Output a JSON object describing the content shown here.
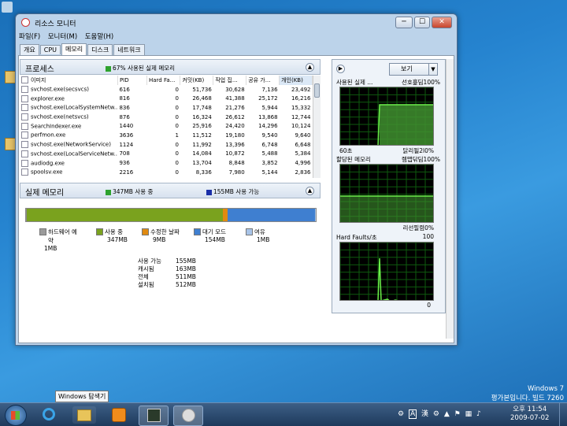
{
  "window": {
    "title": "리소스 모니터",
    "min": "─",
    "max": "☐",
    "close": "✕"
  },
  "menu": [
    "파일(F)",
    "모니터(M)",
    "도움말(H)"
  ],
  "tabs": [
    "개요",
    "CPU",
    "메모리",
    "디스크",
    "네트워크"
  ],
  "process_panel": {
    "title": "프로세스",
    "summary": "67% 사용된 실제 메모리",
    "summary_color": "#2ea22e",
    "columns": [
      "이미지",
      "PID",
      "Hard Fa...",
      "커밋(KB)",
      "작업 집...",
      "공유 가...",
      "개인(KB)"
    ],
    "rows": [
      [
        "svchost.exe(secsvcs)",
        "616",
        "0",
        "51,736",
        "30,628",
        "7,136",
        "23,492"
      ],
      [
        "explorer.exe",
        "816",
        "0",
        "26,468",
        "41,388",
        "25,172",
        "16,216"
      ],
      [
        "svchost.exe(LocalSystemNetw...",
        "836",
        "0",
        "17,748",
        "21,276",
        "5,944",
        "15,332"
      ],
      [
        "svchost.exe(netsvcs)",
        "876",
        "0",
        "16,324",
        "26,612",
        "13,868",
        "12,744"
      ],
      [
        "SearchIndexer.exe",
        "1440",
        "0",
        "25,916",
        "24,420",
        "14,296",
        "10,124"
      ],
      [
        "perfmon.exe",
        "3636",
        "1",
        "11,512",
        "19,180",
        "9,540",
        "9,640"
      ],
      [
        "svchost.exe(NetworkService)",
        "1124",
        "0",
        "11,992",
        "13,396",
        "6,748",
        "6,648"
      ],
      [
        "svchost.exe(LocalServiceNetw...",
        "708",
        "0",
        "14,084",
        "10,872",
        "5,488",
        "5,384"
      ],
      [
        "audiodg.exe",
        "936",
        "0",
        "13,704",
        "8,848",
        "3,852",
        "4,996"
      ],
      [
        "spoolsv.exe",
        "2216",
        "0",
        "8,336",
        "7,980",
        "5,144",
        "2,836"
      ]
    ]
  },
  "memory_panel": {
    "title": "실제 메모리",
    "in_use": "347MB 사용 중",
    "available": "155MB 사용 가능",
    "in_use_color": "#2ea22e",
    "available_color": "#1a2fa8",
    "bar": [
      {
        "label": "하드웨어 예약",
        "value_mb": 1,
        "color": "#8a8a8a"
      },
      {
        "label": "사용 중",
        "value_mb": 347,
        "color": "#7aa21e"
      },
      {
        "label": "수정한 날짜",
        "value_mb": 9,
        "color": "#e08a10"
      },
      {
        "label": "대기 모드",
        "value_mb": 154,
        "color": "#3f7fd0"
      },
      {
        "label": "여유",
        "value_mb": 1,
        "color": "#a8c4e8"
      }
    ],
    "legend": [
      {
        "label": "하드웨어 예\n약",
        "value": "1MB",
        "color": "#9a9a9a"
      },
      {
        "label": "사용 중",
        "value": "347MB",
        "color": "#7aa21e"
      },
      {
        "label": "수정한 날짜",
        "value": "9MB",
        "color": "#e08a10"
      },
      {
        "label": "대기 모드",
        "value": "154MB",
        "color": "#3f7fd0"
      },
      {
        "label": "여유",
        "value": "1MB",
        "color": "#a8c4e8"
      }
    ],
    "stats": [
      [
        "사용 가능",
        "155MB"
      ],
      [
        "캐시됨",
        "163MB"
      ],
      [
        "전체",
        "511MB"
      ],
      [
        "설치됨",
        "512MB"
      ]
    ]
  },
  "right_panel": {
    "view_button": "보기",
    "graphs": [
      {
        "left_label": "사용된 실제 ...",
        "right_label": "선호흝딤100%",
        "bottom_left": "60초",
        "bottom_right": "닭리될2l0%",
        "kind": "step"
      },
      {
        "left_label": "할당된 메모리",
        "right_label": "렘맵닦딤100%",
        "bottom_left": "",
        "bottom_right": "리선필렴0%",
        "kind": "flat"
      },
      {
        "left_label": "Hard Faults/초",
        "right_label": "100",
        "bottom_left": "",
        "bottom_right": "0",
        "kind": "spike"
      }
    ]
  },
  "desktop": {
    "tooltip": "Windows 탐색기",
    "watermark_line1": "Windows 7",
    "watermark_line2": "평가본입니다. 빌드 7260"
  },
  "taskbar": {
    "time": "오후 11:54",
    "date": "2009-07-02"
  }
}
